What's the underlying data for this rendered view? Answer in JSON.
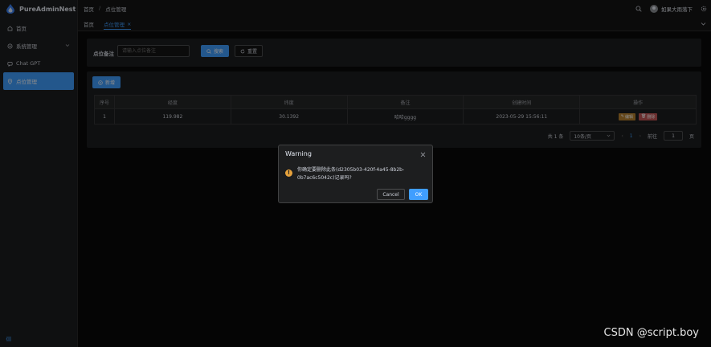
{
  "app": {
    "name": "PureAdminNest"
  },
  "sidebar": {
    "items": [
      {
        "label": "首页",
        "icon": "home-icon"
      },
      {
        "label": "系统管理",
        "icon": "gear-icon",
        "expandable": true
      },
      {
        "label": "Chat GPT",
        "icon": "chat-icon"
      },
      {
        "label": "点位管理",
        "icon": "location-icon",
        "active": true
      }
    ]
  },
  "header": {
    "breadcrumb": [
      "首页",
      "点位管理"
    ],
    "user_name": "如果大雨落下"
  },
  "tags": [
    {
      "label": "首页"
    },
    {
      "label": "点位管理",
      "active": true,
      "close": "×"
    }
  ],
  "search": {
    "label": "点位备注",
    "placeholder": "请输入点位备注",
    "search_button": "搜索",
    "reset_button": "重置"
  },
  "table": {
    "add_button": "新增",
    "columns": [
      "序号",
      "经度",
      "纬度",
      "备注",
      "创建时间",
      "操作"
    ],
    "rows": [
      {
        "index": "1",
        "lng": "119.982",
        "lat": "30.1392",
        "note": "哈哈gggg",
        "created": "2023-05-29 15:56:11",
        "edit": "编辑",
        "delete": "删除"
      }
    ]
  },
  "pager": {
    "total": "共 1 条",
    "size": "10条/页",
    "page": "1",
    "goto_label": "前往",
    "goto_value": "1",
    "page_suffix": "页"
  },
  "dialog": {
    "title": "Warning",
    "message": "你确定要删除此条(d2305b03-420f-4a45-8b2b-0b7ac6c5042c)记录吗?",
    "cancel": "Cancel",
    "ok": "OK"
  },
  "watermark": "CSDN @script.boy",
  "colors": {
    "primary": "#409eff",
    "warning": "#e6a23c",
    "danger": "#c45656",
    "edit": "#b88230"
  }
}
